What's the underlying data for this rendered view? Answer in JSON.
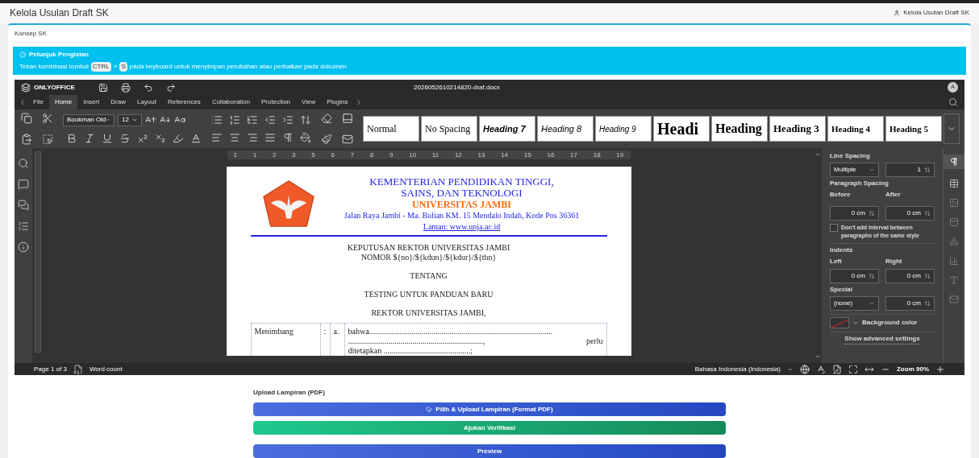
{
  "page": {
    "title": "Kelola Usulan Draft SK",
    "breadcrumb": "Kelola Usulan Draft SK"
  },
  "card": {
    "header": "Konsep SK"
  },
  "info": {
    "title": "Petunjuk Pengisian",
    "text_before": "Tekan kombinasi tombol",
    "keys": [
      "CTRL",
      "S"
    ],
    "joiner": "+",
    "text_after": "pada keyboard untuk menyimpan perubahan atau perbaikan pada dokumen"
  },
  "editor": {
    "brand": "ONLYOFFICE",
    "filename": "2026052610214820-draf.docx",
    "avatar": "A",
    "tabs": [
      {
        "label": "File",
        "selected": false
      },
      {
        "label": "Home",
        "selected": true
      },
      {
        "label": "Insert",
        "selected": false
      },
      {
        "label": "Draw",
        "selected": false
      },
      {
        "label": "Layout",
        "selected": false
      },
      {
        "label": "References",
        "selected": false
      },
      {
        "label": "Collaboration",
        "selected": false
      },
      {
        "label": "Protection",
        "selected": false
      },
      {
        "label": "View",
        "selected": false
      },
      {
        "label": "Plugins",
        "selected": false
      }
    ],
    "font": "Bookman Old",
    "size": "12",
    "styles": [
      "Normal",
      "No Spacing",
      "Heading 7",
      "Heading 8",
      "Heading 9",
      "Headi",
      "Heading",
      "Heading 3",
      "Heading 4",
      "Heading 5"
    ],
    "ruler": [
      "1",
      "1",
      "2",
      "3",
      "5",
      "6",
      "7",
      "8",
      "9",
      "10",
      "11",
      "12",
      "13",
      "14",
      "15",
      "16",
      "17",
      "18",
      "19"
    ],
    "document": {
      "ministry": [
        "KEMENTERIAN PENDIDIKAN TINGGI,",
        "SAINS, DAN TEKNOLOGI"
      ],
      "university": "UNIVERSITAS JAMBI",
      "address": "Jalan Raya Jambi - Ma. Bulian KM. 15 Mendalo Indah, Kode Pos 36361",
      "website": "Laman: www.unja.ac.id",
      "heading": [
        "KEPUTUSAN REKTOR UNIVERSITAS JAMBI",
        "NOMOR  ${no}/${kdun}/${kdur}/${thn}"
      ],
      "about": "TENTANG",
      "subject": "TESTING UNTUK PANDUAN BARU",
      "official": "REKTOR UNIVERSITAS JAMBI,",
      "table": {
        "label": "Menimbang",
        "colon": ":",
        "item": "a.",
        "lines": [
          "bahwa...........................................................................................",
          "...................................................................,",
          "ditetapkan ...........................................;"
        ],
        "trailing": "perlu"
      }
    },
    "panel": {
      "line_spacing": "Line Spacing",
      "line_mode": "Multiple",
      "line_value": "1",
      "paragraph_spacing": "Paragraph Spacing",
      "before": "Before",
      "after": "After",
      "before_value": "0 cm",
      "after_value": "0 cm",
      "no_interval": {
        "label": "Don't add interval between paragraphs of the same style",
        "checked": false
      },
      "indents": "Indents",
      "left": "Left",
      "right": "Right",
      "left_value": "0 cm",
      "right_value": "0 cm",
      "special": "Special",
      "special_mode": "(none)",
      "special_value": "0 cm",
      "background": "Background color",
      "advanced": "Show advanced settings"
    },
    "status": {
      "page": "Page 1 of 3",
      "word_count": "Word count",
      "language": "Bahasa Indonesia (Indonesia)",
      "zoom": "Zoom 90%"
    }
  },
  "upload": {
    "label": "Upload Lampiran (PDF)",
    "buttons": [
      {
        "label": "Pilih & Upload Lampiran (Format PDF)",
        "kind": "upload"
      },
      {
        "label": "Ajukan Verifikasi",
        "kind": "submit"
      },
      {
        "label": "Preview",
        "kind": "preview"
      }
    ]
  }
}
